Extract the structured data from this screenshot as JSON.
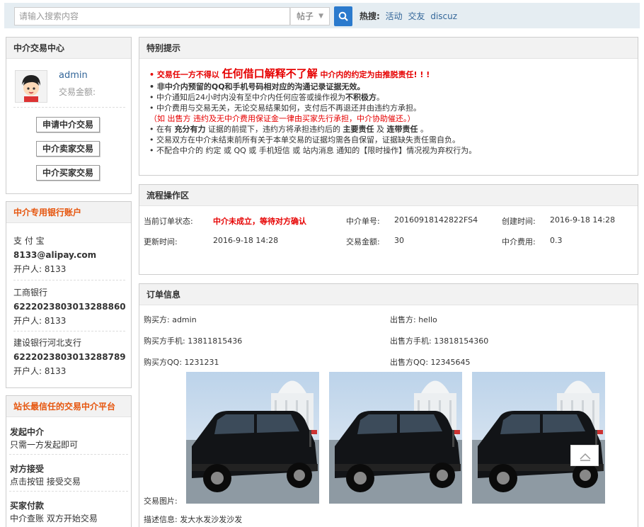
{
  "search": {
    "placeholder": "请输入搜索内容",
    "type": "帖子",
    "hot_label": "热搜:",
    "hot_items": [
      "活动",
      "交友",
      "discuz"
    ]
  },
  "center": {
    "title": "中介交易中心",
    "username": "admin",
    "money_label": "交易金额:",
    "buttons": [
      "申请中介交易",
      "中介卖家交易",
      "中介买家交易"
    ]
  },
  "bank": {
    "title": "中介专用银行账户",
    "accounts": [
      {
        "name": "支 付 宝",
        "number": "8133@alipay.com",
        "holder": "开户人: 8133"
      },
      {
        "name": "工商银行",
        "number": "6222023803013288860",
        "holder": "开户人: 8133"
      },
      {
        "name": "建设银行河北支行",
        "number": "6222023803013288789",
        "holder": "开户人: 8133"
      }
    ]
  },
  "platform": {
    "title": "站长最信任的交易中介平台",
    "items": [
      {
        "head": "发起中介",
        "desc": "只需一方发起即可"
      },
      {
        "head": "对方接受",
        "desc": "点击按钮 接受交易"
      },
      {
        "head": "买家付款",
        "desc": "中介查账 双方开始交易"
      }
    ]
  },
  "notice": {
    "title": "特别提示",
    "line1_a": "• 交易任一方不得以 ",
    "line1_b": "任何借口解释不了解",
    "line1_c": " 中介内的约定为由推脱责任! ! !",
    "line2": "• 非中介内预留的QQ和手机号码相对应的沟通记录证据无效。",
    "line3_a": "• 中介通知后24小时内没有至中介内任何应答或操作视为",
    "line3_b": "不积极方",
    "line3_c": "。",
    "line4": "• 中介费用与交易无关，无论交易结果如何，支付后不再退还并由违约方承担。",
    "line5": "（如 出售方 违约及无中介费用保证金一律由买家先行承担，中介协助催还。）",
    "line6_a": "• 在有 ",
    "line6_b": "充分有力",
    "line6_c": " 证据的前提下，违约方将承担违约后的 ",
    "line6_d": "主要责任",
    "line6_e": " 及 ",
    "line6_f": "连带责任",
    "line6_g": " 。",
    "line7": "• 交易双方在中介未结束前所有关于本单交易的证据均需各自保留，证据缺失责任需自负。",
    "line8": "• 不配合中介的 约定 或 QQ 或 手机短信 或 站内消息 通知的【限时操作】情况视为弃权行为。"
  },
  "flow": {
    "title": "流程操作区",
    "status_label": "当前订单状态:",
    "status_value": "中介未成立，等待对方确认",
    "order_no_label": "中介单号:",
    "order_no": "20160918142822FS4",
    "created_label": "创建时间:",
    "created": "2016-9-18 14:28",
    "updated_label": "更新时间:",
    "updated": "2016-9-18 14:28",
    "amount_label": "交易金额:",
    "amount": "30",
    "fee_label": "中介费用:",
    "fee": "0.3"
  },
  "order": {
    "title": "订单信息",
    "buyer": "购买方:  admin",
    "seller": "出售方:  hello",
    "buyer_phone": "购买方手机:  13811815436",
    "seller_phone": "出售方手机:  13818154360",
    "buyer_qq": "购买方QQ:  1231231",
    "seller_qq": "出售方QQ:  12345645",
    "image_label": "交易图片:",
    "desc": "描述信息:  发大水发沙发沙发"
  },
  "colors": {
    "accent_blue": "#2b7acd",
    "link": "#336699",
    "warning_red": "#e60000",
    "title_orange": "#e6550d"
  }
}
